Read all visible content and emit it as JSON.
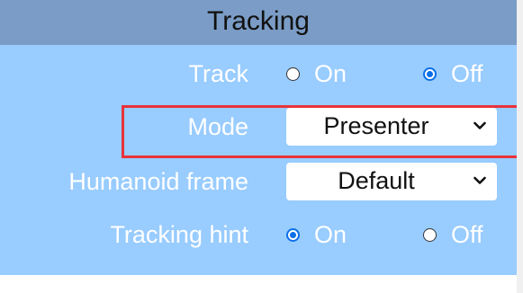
{
  "panel": {
    "title": "Tracking"
  },
  "rows": {
    "track": {
      "label": "Track",
      "options": [
        "On",
        "Off"
      ],
      "selected": "Off"
    },
    "mode": {
      "label": "Mode",
      "value": "Presenter"
    },
    "humanoid_frame": {
      "label": "Humanoid frame",
      "value": "Default"
    },
    "tracking_hint": {
      "label": "Tracking hint",
      "options": [
        "On",
        "Off"
      ],
      "selected": "On"
    }
  },
  "icons": {
    "dropdown": "chevron-down-icon",
    "radio_checked": "radio-checked-icon",
    "radio_unchecked": "radio-unchecked-icon"
  },
  "colors": {
    "panel_bg": "#99ccff",
    "header_bg": "#7a9cc6",
    "highlight": "#e8333a",
    "radio_accent": "#0a6fe8"
  }
}
